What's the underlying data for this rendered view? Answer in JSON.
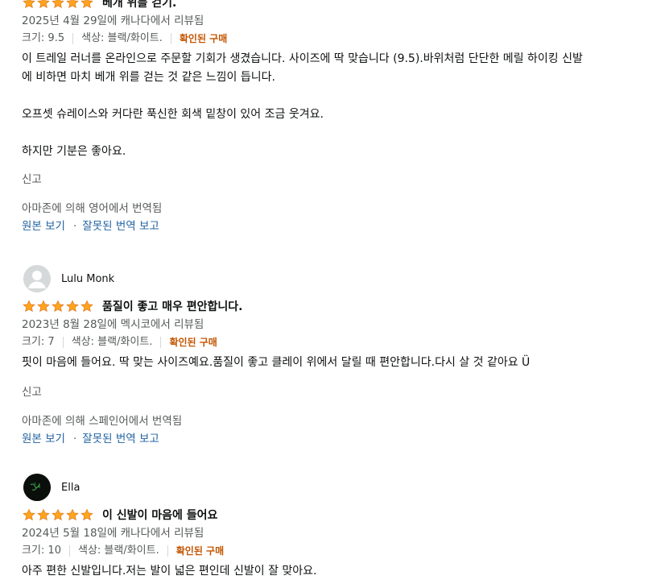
{
  "reviews": [
    {
      "title": "베개 위를 걷기.",
      "rating": 5,
      "date": "2025년 4월 29일에 캐나다에서 리뷰됨",
      "size": "크기: 9.5",
      "color": "색상: 블랙/화이트.",
      "verified": "확인된 구매",
      "body": [
        "이 트레일 러너를 온라인으로 주문할 기회가 생겼습니다. 사이즈에 딱 맞습니다 (9.5).바위처럼 단단한 메릴 하이킹 신발",
        "에 비하면 마치 베개 위를 걷는 것 같은 느낌이 듭니다.",
        "",
        "오프셋 슈레이스와 커다란 푹신한 회색 밑창이 있어 조금 웃겨요.",
        "",
        "하지만 기분은 좋아요."
      ],
      "report": "신고",
      "translated": "아마존에 의해 영어에서 번역됨",
      "original_link": "원본 보기",
      "bad_translation_link": "잘못된 번역 보고"
    },
    {
      "author": "Lulu Monk",
      "title": "품질이 좋고 매우 편안합니다.",
      "rating": 5,
      "date": "2023년 8월 28일에 멕시코에서 리뷰됨",
      "size": "크기: 7",
      "color": "색상: 블랙/화이트.",
      "verified": "확인된 구매",
      "body": [
        "핏이 마음에 들어요. 딱 맞는 사이즈예요.품질이 좋고 클레이 위에서 달릴 때 편안합니다.다시 살 것 같아요 Ü"
      ],
      "report": "신고",
      "translated": "아마존에 의해 스페인어에서 번역됨",
      "original_link": "원본 보기",
      "bad_translation_link": "잘못된 번역 보고"
    },
    {
      "author": "Ella",
      "title": "이 신발이 마음에 들어요",
      "rating": 5,
      "date": "2024년 5월 18일에 캐나다에서 리뷰됨",
      "size": "크기: 10",
      "color": "색상: 블랙/화이트.",
      "verified": "확인된 구매",
      "body": [
        "아주 편한 신발입니다.저는 발이 넓은 편인데 신발이 잘 맞아요."
      ]
    }
  ],
  "colors": {
    "star": "#ffa41c",
    "star_stroke": "#de7921",
    "link": "#2162a1",
    "verified": "#c45500",
    "meta": "#565959"
  }
}
